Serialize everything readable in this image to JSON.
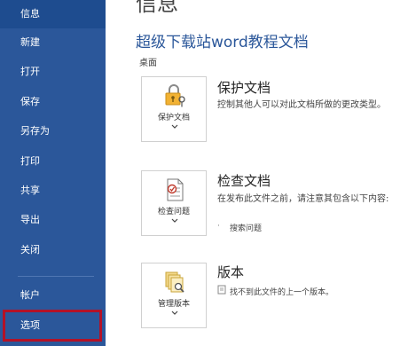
{
  "sidebar": {
    "items": [
      {
        "label": "信息",
        "active": true
      },
      {
        "label": "新建"
      },
      {
        "label": "打开"
      },
      {
        "label": "保存"
      },
      {
        "label": "另存为"
      },
      {
        "label": "打印"
      },
      {
        "label": "共享"
      },
      {
        "label": "导出"
      },
      {
        "label": "关闭"
      },
      {
        "label": "帐户"
      },
      {
        "label": "选项"
      }
    ]
  },
  "main": {
    "page_title": "信息",
    "doc_title": "超级下载站word教程文档",
    "doc_location": "桌面",
    "protect": {
      "button_label": "保护文档",
      "heading": "保护文档",
      "description": "控制其他人可以对此文档所做的更改类型。"
    },
    "inspect": {
      "button_label": "检查问题",
      "heading": "检查文档",
      "description": "在发布此文件之前，请注意其包含以下内容:",
      "bullet_mark": "·",
      "item": "搜索问题"
    },
    "versions": {
      "button_label": "管理版本",
      "heading": "版本",
      "item": "找不到此文件的上一个版本。"
    }
  },
  "colors": {
    "sidebar": "#2b579a",
    "accent_text": "#2b579a",
    "highlight_border": "#b31227"
  }
}
